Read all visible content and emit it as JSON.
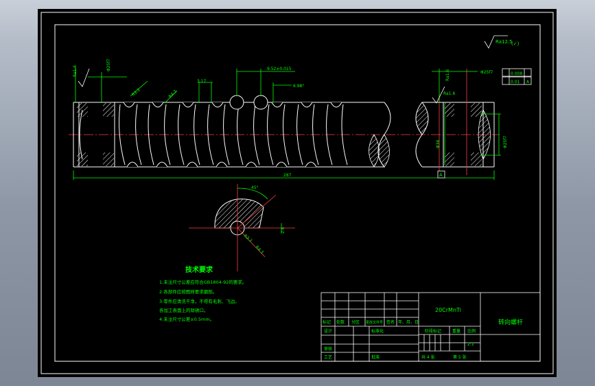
{
  "drawing": {
    "title": "转向螺杆",
    "material": "20CrMnTi",
    "scale": "2:1",
    "sheet_total": "共 4 张",
    "sheet_no": "第 5 张"
  },
  "tech_requirements": {
    "heading": "技术要求",
    "items": [
      "1.未注尺寸公差应符合GB1804-92的要求。",
      "2.各部件应按图样要求磨削。",
      "3.零件应清洗干净，不得有毛刺、飞边。",
      "  各加工表面上的除锈口。",
      "4.未注尺寸公差±0.5mm。"
    ]
  },
  "title_block_labels": {
    "row_labels": [
      "标记",
      "处数",
      "分区",
      "更改文件号",
      "签名",
      "年、月、日"
    ],
    "design": "设计",
    "standardize": "标准化",
    "stage_mark": "阶段标记",
    "weight": "重量",
    "ratio": "比例",
    "review": "审核",
    "process": "工艺",
    "approve": "批准"
  },
  "dimensions": {
    "overall_length": "287",
    "pitch_dim": "9.52±0.015",
    "angle_a": "6.98°",
    "groove_r": "R3.2",
    "groove_r2": "R4.3",
    "thread_dim": "3.17",
    "diameter_left": "Φ25f7",
    "diameter_mid": "Φ34",
    "diameter_right": "Φ25f7",
    "section_angle": "45°",
    "section_r1": "R3.2",
    "section_r2": "R4.3",
    "section_dim": "2.6",
    "roughness_main": "Ra12.5",
    "roughness_paren": "(✓)",
    "roughness_left": "Ra1.6",
    "roughness_right": "Ra1.6",
    "roughness_right2": "Ra1.6",
    "datum_a": "A",
    "tol_1": "0.008",
    "tol_2": "0.01",
    "tol_ref": "A"
  }
}
